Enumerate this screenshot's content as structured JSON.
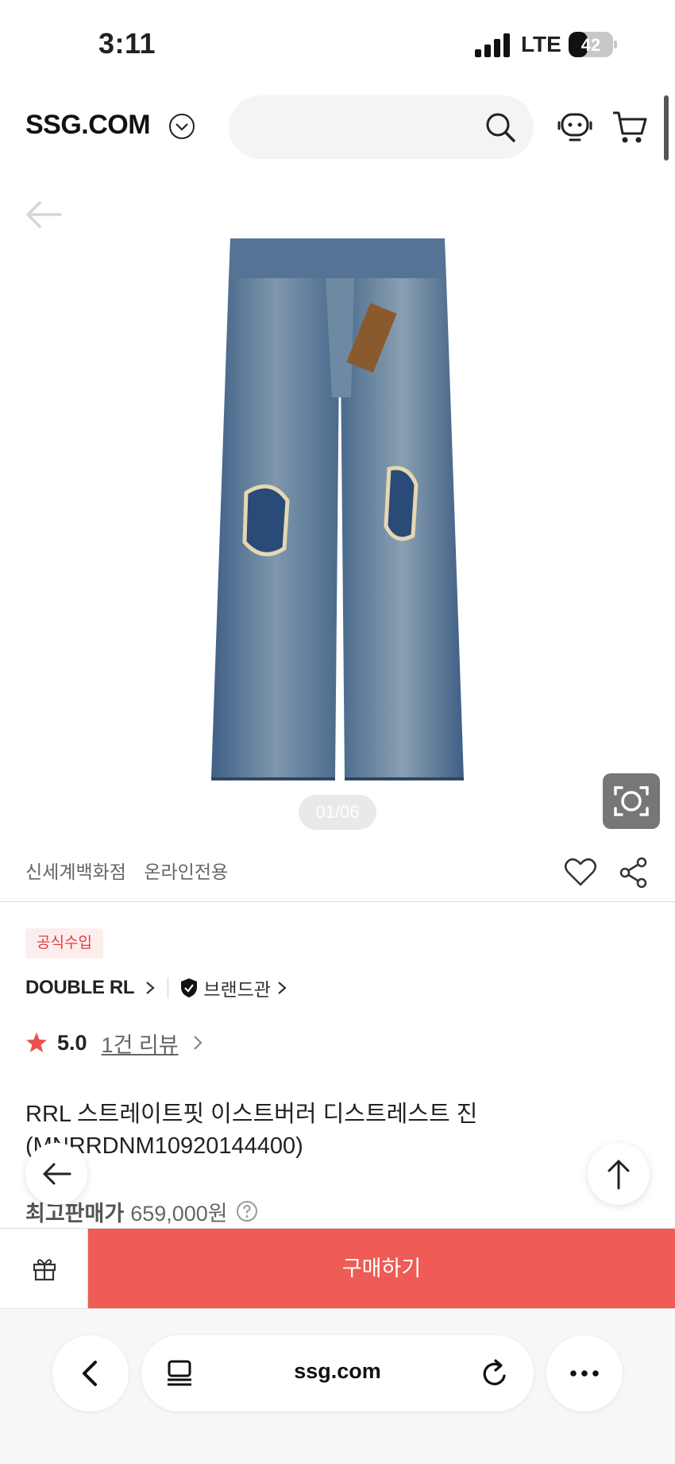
{
  "status_bar": {
    "time": "3:11",
    "network": "LTE",
    "battery": "42"
  },
  "header": {
    "logo": "SSG.COM",
    "search_placeholder": ""
  },
  "gallery": {
    "counter": "01/06"
  },
  "store_tags": [
    "신세계백화점",
    "온라인전용"
  ],
  "product": {
    "badge": "공식수입",
    "brand": "DOUBLE RL",
    "brand_hall": "브랜드관",
    "rating": "5.0",
    "review_count": "1건 리뷰",
    "title": "RRL 스트레이트핏 이스트버러 디스트레스트 진(MNRRDNM10920144400)",
    "price_label": "최고판매가",
    "price_value": "659,000원"
  },
  "actions": {
    "buy_label": "구매하기"
  },
  "browser": {
    "url": "ssg.com"
  },
  "colors": {
    "accent": "#ef5b55",
    "badge_text": "#e53935",
    "badge_bg": "#fdeeee",
    "star": "#e8524f"
  }
}
